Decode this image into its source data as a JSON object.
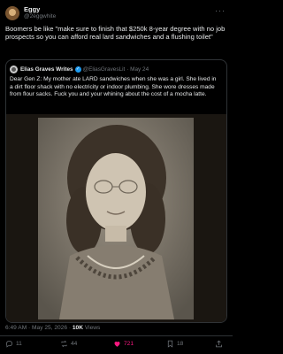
{
  "tweet": {
    "author_name": "Eggy",
    "author_handle": "@2eggwhite",
    "text": "Boomers be like \"make sure to finish that $250k 8-year degree with no job prospects so you can afford real lard sandwiches and a flushing toilet\"",
    "timestamp": "6:49 AM · May 25, 2026 ·",
    "views_count": "10K",
    "views_label": "Views"
  },
  "quoted_tweet": {
    "author_name": "Elias Graves Writes",
    "author_handle": "@EliasGravesLit",
    "date": "· May 24",
    "text": "Dear Gen Z: My mother ate LARD sandwiches when she was a girl. She lived in a dirt floor shack with no electricity or indoor plumbing. She wore dresses made from flour sacks. Fuck you and your whining about the cost of a mocha latte."
  },
  "actions": {
    "replies": "11",
    "reposts": "44",
    "likes": "721",
    "bookmarks": "18"
  },
  "icons": {
    "more": "more-icon",
    "verified": "verified-badge-icon",
    "reply": "reply-icon",
    "repost": "repost-icon",
    "like": "heart-icon",
    "bookmark": "bookmark-icon",
    "share": "share-icon"
  },
  "colors": {
    "background": "#000000",
    "text": "#e7e9ea",
    "secondary": "#71767b",
    "accent": "#1d9bf0",
    "like": "#f91880"
  }
}
